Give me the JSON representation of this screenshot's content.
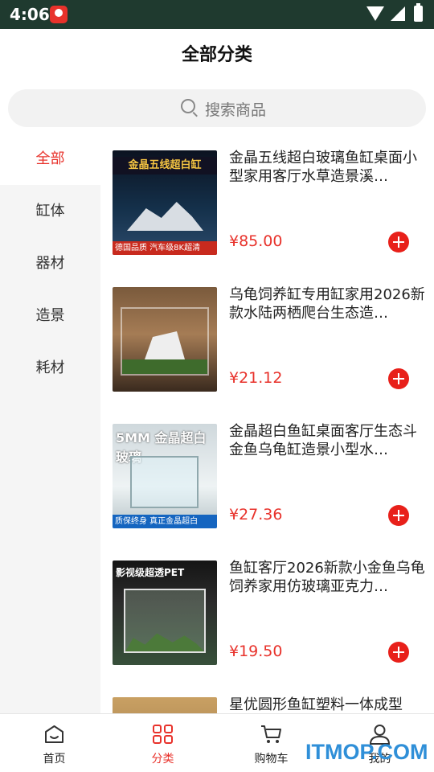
{
  "status_bar": {
    "time": "4:06"
  },
  "header": {
    "title": "全部分类"
  },
  "search": {
    "placeholder": "搜索商品"
  },
  "sidebar": {
    "items": [
      {
        "label": "全部",
        "active": true
      },
      {
        "label": "缸体",
        "active": false
      },
      {
        "label": "器材",
        "active": false
      },
      {
        "label": "造景",
        "active": false
      },
      {
        "label": "耗材",
        "active": false
      }
    ]
  },
  "products": [
    {
      "name": "金晶五线超白玻璃鱼缸桌面小型家用客厅水草造景溪…",
      "price": "¥85.00",
      "image_text_top": "金晶五线超白缸",
      "image_text_bottom": "德国品质 汽车级8K超清"
    },
    {
      "name": "乌龟饲养缸专用缸家用2026新款水陆两栖爬台生态造…",
      "price": "¥21.12"
    },
    {
      "name": "金晶超白鱼缸桌面客厅生态斗金鱼乌龟缸造景小型水…",
      "price": "¥27.36",
      "image_text_top": "5MM 金晶超白玻璃",
      "image_text_bottom": "质保终身 真正金晶超白"
    },
    {
      "name": "鱼缸客厅2026新款小金鱼乌龟饲养家用仿玻璃亚克力…",
      "price": "¥19.50",
      "image_text_top": "影视级超透PET"
    },
    {
      "name": "星优圆形鱼缸塑料一体成型",
      "price": ""
    }
  ],
  "tab_bar": {
    "tabs": [
      {
        "label": "首页",
        "icon": "home-icon",
        "active": false
      },
      {
        "label": "分类",
        "icon": "grid-icon",
        "active": true
      },
      {
        "label": "购物车",
        "icon": "cart-icon",
        "active": false
      },
      {
        "label": "我的",
        "icon": "user-icon",
        "active": false
      }
    ]
  },
  "watermark": "ITMOP.COM",
  "colors": {
    "accent": "#e8322b",
    "status_bar": "#1f3a2f",
    "sidebar_bg": "#f5f5f5"
  }
}
